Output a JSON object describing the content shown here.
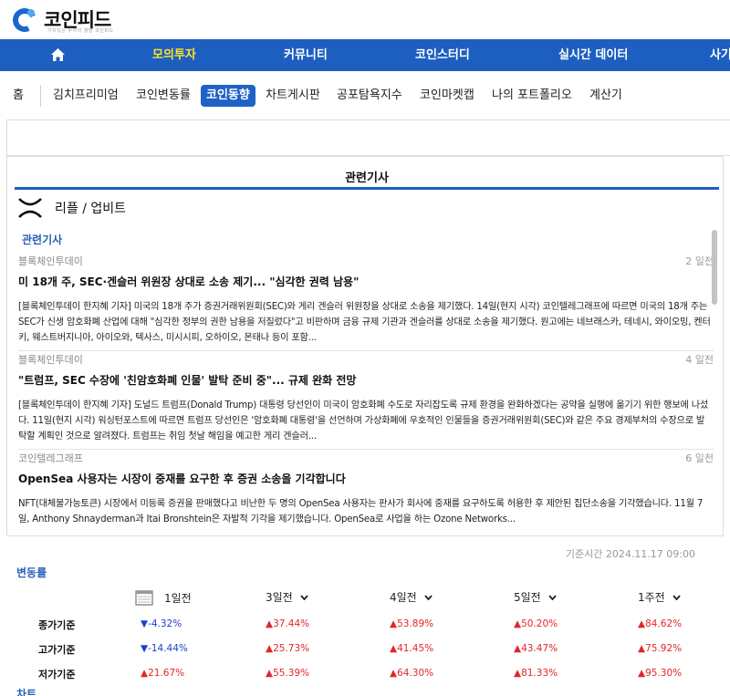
{
  "brand": {
    "name": "코인피드",
    "tagline": "가치있는 투자의 향방 코인피드"
  },
  "main_nav": [
    "모의투자",
    "커뮤니티",
    "코인스터디",
    "실시간 데이터",
    "사기"
  ],
  "sub_nav": [
    "홈",
    "김치프리미엄",
    "코인변동률",
    "코인동향",
    "차트게시판",
    "공포탐욕지수",
    "코인마켓캡",
    "나의 포트폴리오",
    "계산기"
  ],
  "news": {
    "title": "관련기사",
    "coin": "리플 / 업비트",
    "section": "관련기사",
    "articles": [
      {
        "source": "블록체인투데이",
        "date": "2 일전",
        "headline": "미 18개 주, SEC·겐슬러 위원장 상대로 소송 제기... \"심각한 권력 남용\"",
        "body": "[블록체인투데이 한지혜 기자] 미국의 18개 주가 증권거래위원회(SEC)와 게리 겐슬러 위원장을 상대로 소송을 제기했다. 14일(현지 시각) 코인텔레그래프에 따르면 미국의 18개 주는 SEC가 신생 암호화폐 산업에 대해 \"심각한 정부의 권한 남용을 저질렀다\"고 비판하며 금융 규제 기관과 겐슬러를 상대로 소송을 제기했다. 원고에는 네브래스카, 테네시, 와이오밍, 켄터키, 웨스트버지니아, 아이오와, 텍사스, 미시시피, 오하이오, 몬태나 등이 포함..."
      },
      {
        "source": "블록체인투데이",
        "date": "4 일전",
        "headline": "\"트럼프, SEC 수장에 '친암호화폐 인물' 발탁 준비 중\"... 규제 완화 전망",
        "body": "[블록체인투데이 한지혜 기자] 도널드 트럼프(Donald Trump) 대통령 당선인이 미국이 암호화폐 수도로 자리잡도록 규제 환경을 완화하겠다는 공약을 실행에 옮기기 위한 행보에 나섰다. 11일(현지 시각) 워싱턴포스트에 따르면 트럼프 당선인은 '암호화폐 대통령'을 선언하며 가상화폐에 우호적인 인물들을 증권거래위원회(SEC)와 같은 주요 경제부처의 수장으로 발탁할 계획인 것으로 알려졌다. 트럼프는 취임 첫날 해임을 예고한 게리 겐슬러..."
      },
      {
        "source": "코인텔레그래프",
        "date": "6 일전",
        "headline": "OpenSea 사용자는 시장이 중재를 요구한 후 증권 소송을 기각합니다",
        "body": "NFT(대체불가능토큰) 시장에서 미등록 증권을 판매했다고 비난한 두 명의 OpenSea 사용자는 판사가 회사에 중재를 요구하도록 허용한 후 제안된 집단소송을 기각했습니다. 11월 7일, Anthony Shnayderman과 Itai Bronshtein은 자발적 기각을 제기했습니다. OpenSea로 사업을 하는 Ozone Networks..."
      }
    ]
  },
  "rates": {
    "reference_time": "기준시간 2024.11.17 09:00",
    "label": "변동률",
    "columns": [
      "1일전",
      "3일전",
      "4일전",
      "5일전",
      "1주전"
    ],
    "rows": [
      {
        "label": "종가기준",
        "values": [
          "▼-4.32%",
          "▲37.44%",
          "▲53.89%",
          "▲50.20%",
          "▲84.62%"
        ],
        "dirs": [
          "down",
          "up",
          "up",
          "up",
          "up"
        ]
      },
      {
        "label": "고가기준",
        "values": [
          "▼-14.44%",
          "▲25.73%",
          "▲41.45%",
          "▲43.47%",
          "▲75.92%"
        ],
        "dirs": [
          "down",
          "up",
          "up",
          "up",
          "up"
        ]
      },
      {
        "label": "저가기준",
        "values": [
          "▲21.67%",
          "▲55.39%",
          "▲64.30%",
          "▲81.33%",
          "▲95.30%"
        ],
        "dirs": [
          "up",
          "up",
          "up",
          "up",
          "up"
        ]
      }
    ]
  },
  "chart_section_label": "차트",
  "colors": {
    "nav_blue": "#1c5fc0",
    "active_yellow": "#ffe227",
    "up_red": "#e3252a",
    "down_blue": "#1a3fcf"
  }
}
